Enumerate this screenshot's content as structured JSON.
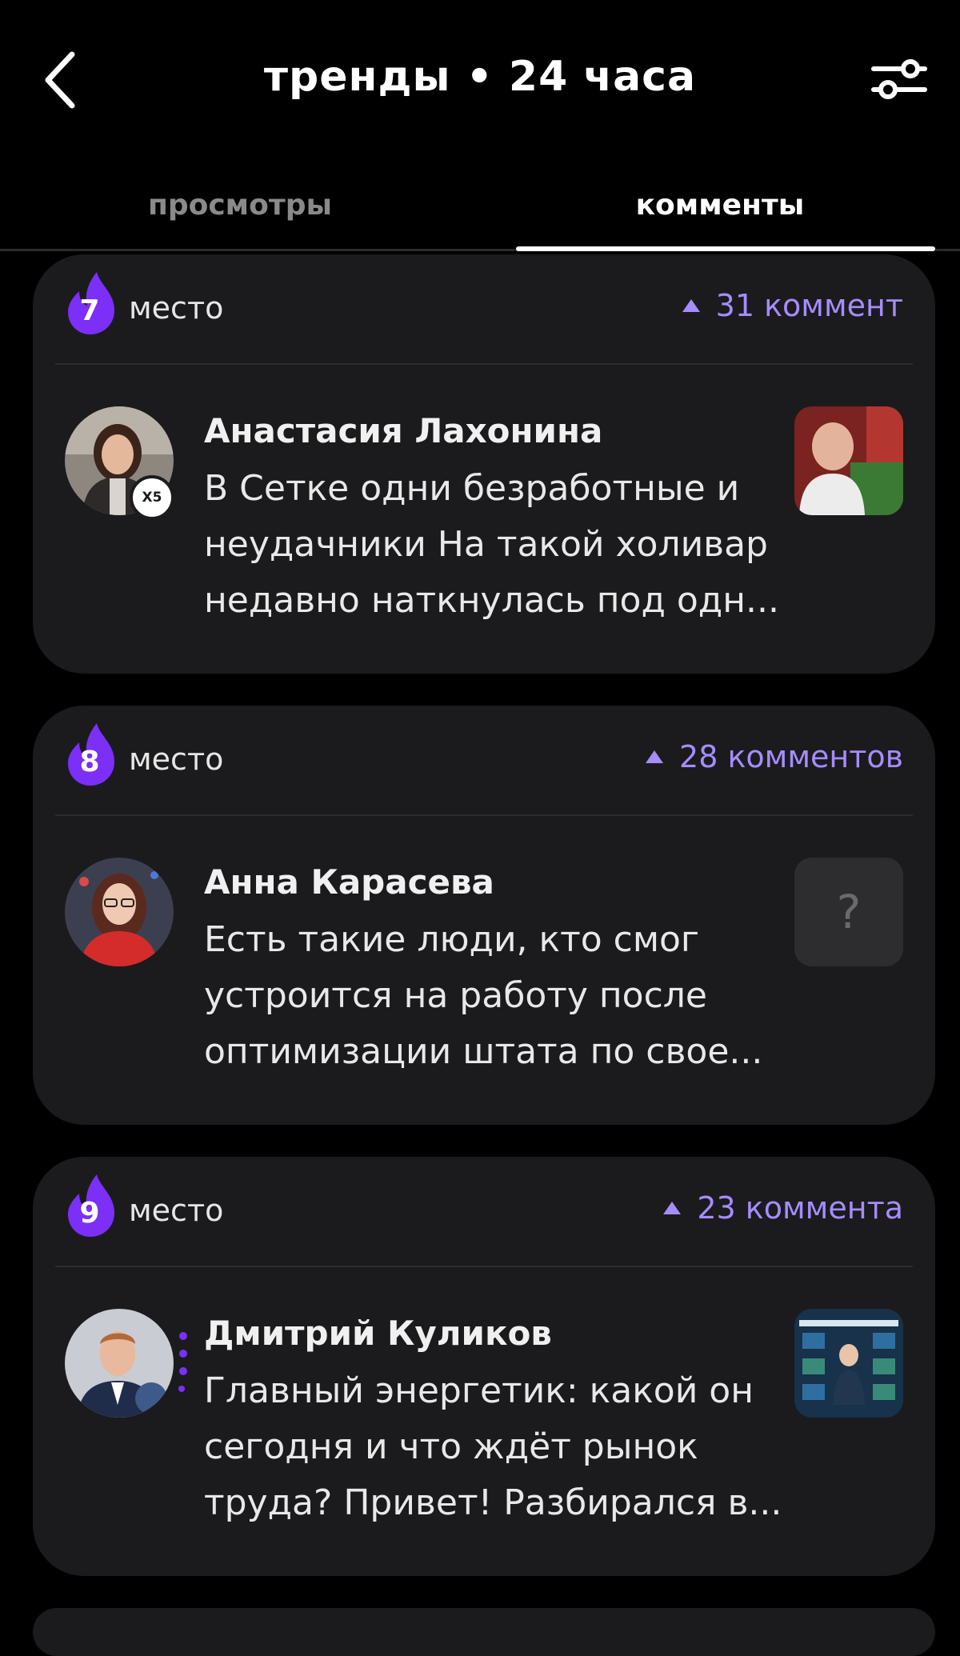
{
  "header": {
    "title": "тренды • 24 часа"
  },
  "tabs": [
    {
      "label": "просмотры",
      "active": false
    },
    {
      "label": "комменты",
      "active": true
    }
  ],
  "colors": {
    "accent": "#a68cff",
    "flame": "#7b2ff7",
    "card_bg": "#1b1b1d"
  },
  "cards": [
    {
      "rank": "7",
      "place_label": "место",
      "count": "31 коммент",
      "author": "Анастасия Лахонина",
      "company_badge": "X5",
      "text": "В Сетке одни безработные и неудачники На такой холивар недавно наткнулась под одн...",
      "thumb": "photo"
    },
    {
      "rank": "8",
      "place_label": "место",
      "count": "28 комментов",
      "author": "Анна Карасева",
      "text": "Есть такие люди, кто смог устроится на работу после оптимизации штата по свое...",
      "thumb": "?"
    },
    {
      "rank": "9",
      "place_label": "место",
      "count": "23 коммента",
      "author": "Дмитрий Куликов",
      "text": "Главный энергетик: какой он сегодня и что ждёт рынок труда? Привет! Разбирался в...",
      "thumb": "infographic"
    }
  ]
}
